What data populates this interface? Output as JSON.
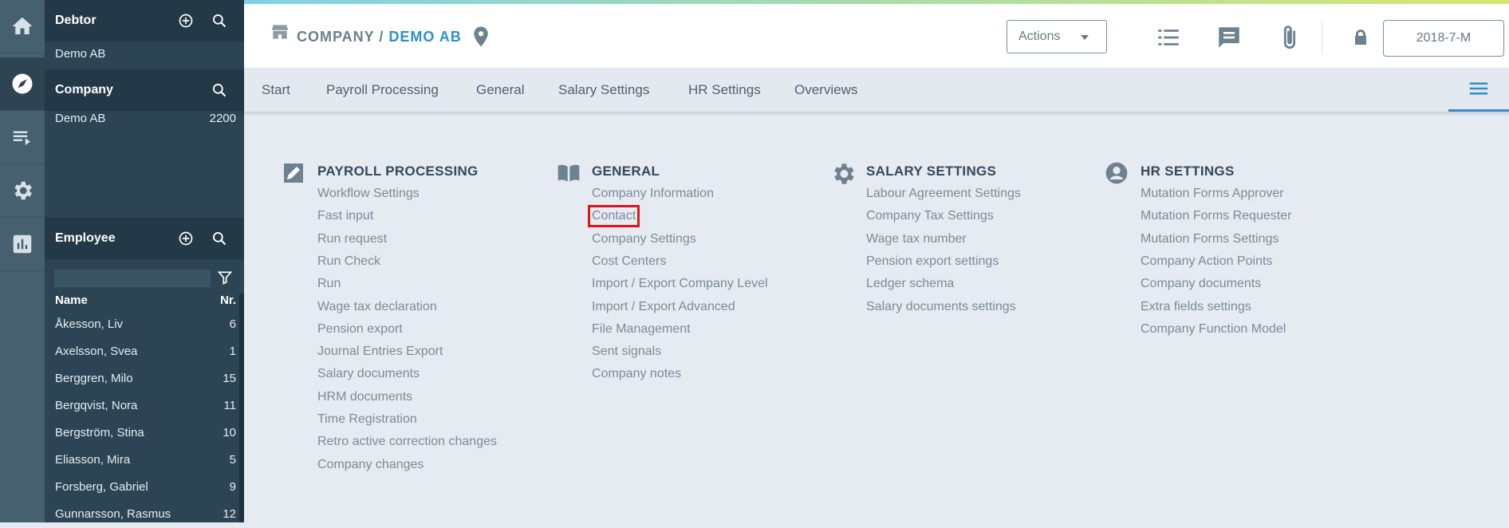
{
  "rail": [
    "home-icon",
    "compass-icon",
    "list-play-icon",
    "gear-icon",
    "bar-chart-icon"
  ],
  "sidebar": {
    "debtor": {
      "title": "Debtor",
      "value": "Demo AB"
    },
    "company": {
      "title": "Company",
      "name": "Demo AB",
      "number": "2200"
    },
    "employee": {
      "title": "Employee",
      "col_name": "Name",
      "col_nr": "Nr.",
      "rows": [
        {
          "name": "Åkesson, Liv",
          "nr": "6"
        },
        {
          "name": "Axelsson, Svea",
          "nr": "1"
        },
        {
          "name": "Berggren, Milo",
          "nr": "15"
        },
        {
          "name": "Bergqvist, Nora",
          "nr": "11"
        },
        {
          "name": "Bergström, Stina",
          "nr": "10"
        },
        {
          "name": "Eliasson, Mira",
          "nr": "5"
        },
        {
          "name": "Forsberg, Gabriel",
          "nr": "9"
        },
        {
          "name": "Gunnarsson, Rasmus",
          "nr": "12"
        }
      ]
    }
  },
  "header": {
    "breadcrumb_root": "COMPANY",
    "breadcrumb_sep": " / ",
    "breadcrumb_current": "DEMO AB",
    "actions_label": "Actions",
    "period": "2018-7-M"
  },
  "tabs": [
    "Start",
    "Payroll Processing",
    "General",
    "Salary Settings",
    "HR Settings",
    "Overviews"
  ],
  "columns": [
    {
      "title": "PAYROLL PROCESSING",
      "icon": "edit-square-icon",
      "links": [
        "Workflow Settings",
        "Fast input",
        "Run request",
        "Run Check",
        "Run",
        "Wage tax declaration",
        "Pension export",
        "Journal Entries Export",
        "Salary documents",
        "HRM documents",
        "Time Registration",
        "Retro active correction changes",
        "Company changes"
      ]
    },
    {
      "title": "GENERAL",
      "icon": "book-icon",
      "links": [
        "Company Information",
        "Contact",
        "Company Settings",
        "Cost Centers",
        "Import / Export Company Level",
        "Import / Export Advanced",
        "File Management",
        "Sent signals",
        "Company notes"
      ]
    },
    {
      "title": "SALARY SETTINGS",
      "icon": "gear-icon",
      "links": [
        "Labour Agreement Settings",
        "Company Tax Settings",
        "Wage tax number",
        "Pension export settings",
        "Ledger schema",
        "Salary documents settings"
      ]
    },
    {
      "title": "HR SETTINGS",
      "icon": "account-circle-icon",
      "links": [
        "Mutation Forms Approver",
        "Mutation Forms Requester",
        "Mutation Forms Settings",
        "Company Action Points",
        "Company documents",
        "Extra fields settings",
        "Company Function Model"
      ]
    }
  ]
}
